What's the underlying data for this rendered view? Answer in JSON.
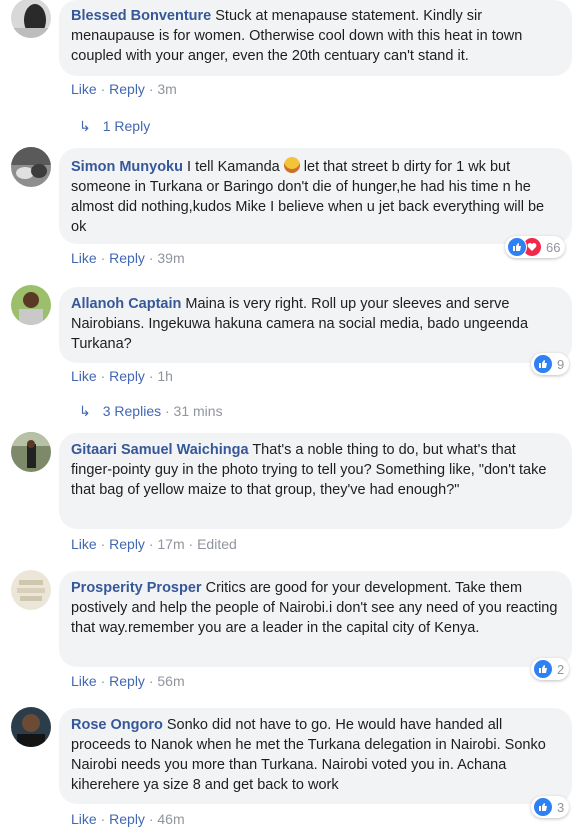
{
  "common": {
    "like": "Like",
    "reply": "Reply"
  },
  "comments": [
    {
      "author": "Blessed Bonventure",
      "text": "Stuck at menapause statement. Kindly sir menaupause is for women. Otherwise cool down with this heat in town coupled with your anger, even the 20th centuary can't stand it.",
      "time": "3m"
    },
    {
      "author": "Simon Munyoku",
      "text_before": "I tell Kamanda",
      "text_after": "let that street b dirty for 1 wk but someone in Turkana or Baringo don't die of hunger,he had his time n he almost did nothing,kudos Mike I believe when u jet back everything will be ok",
      "time": "39m",
      "reactions": {
        "icons": [
          "like",
          "love"
        ],
        "count": "66"
      }
    },
    {
      "author": "Allanoh Captain",
      "text": "Maina is very right. Roll up your sleeves and serve Nairobians. Ingekuwa hakuna camera na social media, bado ungeenda Turkana?",
      "time": "1h",
      "reactions": {
        "icons": [
          "like"
        ],
        "count": "9"
      }
    },
    {
      "author": "Gitaari Samuel Waichinga",
      "text": "That's a noble thing to do, but what's that finger-pointy guy in the photo trying to tell you? Something like, \"don't take that bag of yellow maize to that group, they've had enough?\"",
      "time": "17m",
      "edited": "Edited"
    },
    {
      "author": "Prosperity Prosper",
      "text": "Critics are good for your development. Take them postively and help the people of Nairobi.i don't see any need of you reacting that way.remember you are a leader in the capital city of Kenya.",
      "time": "56m",
      "reactions": {
        "icons": [
          "like"
        ],
        "count": "2"
      }
    },
    {
      "author": "Rose Ongoro",
      "text": "Sonko did not have to go. He would have handed all proceeds to Nanok when he met the Turkana delegation in Nairobi. Sonko Nairobi needs you more than Turkana. Nairobi voted you in. Achana kiherehere ya size 8 and get back to work",
      "time": "46m",
      "reactions": {
        "icons": [
          "like"
        ],
        "count": "3"
      }
    }
  ],
  "reply_links": [
    {
      "label": "1 Reply"
    },
    {
      "label": "3 Replies",
      "time": "· 31 mins"
    }
  ]
}
